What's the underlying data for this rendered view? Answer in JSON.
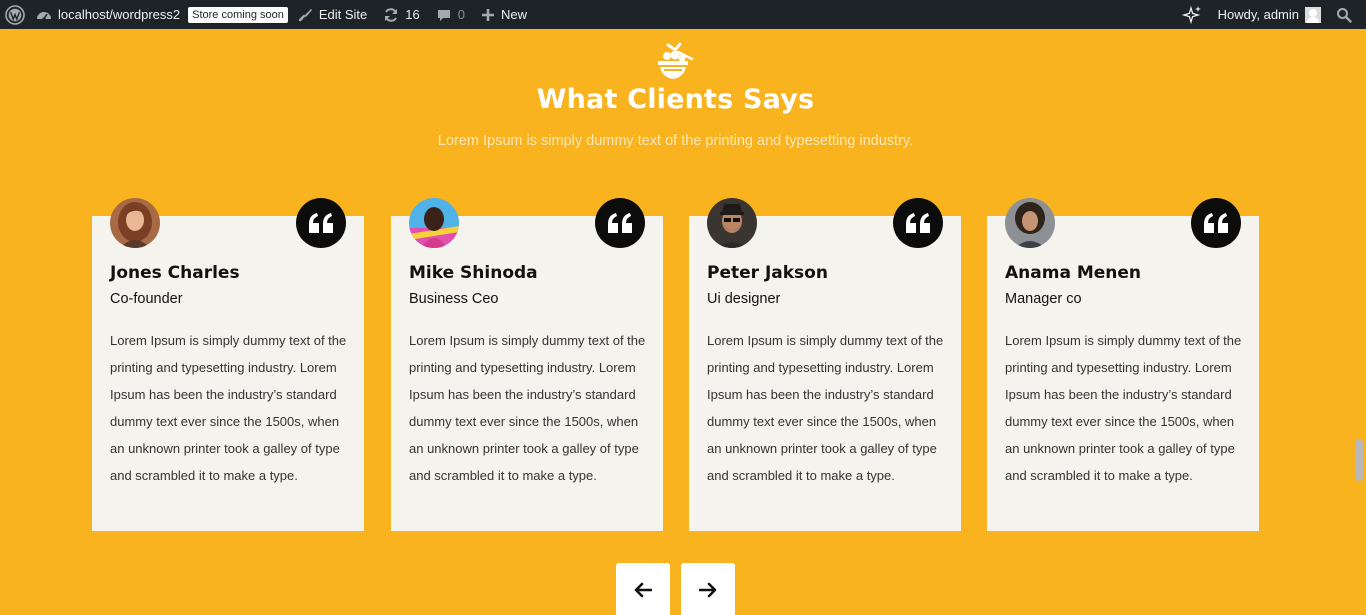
{
  "adminbar": {
    "site_url": "localhost/wordpress2",
    "store_badge": "Store coming soon",
    "edit_site": "Edit Site",
    "updates_count": "16",
    "comments_count": "0",
    "new_label": "New",
    "howdy": "Howdy, admin",
    "icons": [
      "wordpress-icon",
      "dashboard-icon",
      "brush-icon",
      "updates-icon",
      "comment-icon",
      "plus-icon",
      "sparkle-icon",
      "avatar-icon",
      "search-icon"
    ]
  },
  "section": {
    "icon": "food-bowl-icon",
    "title": "What Clients Says",
    "subtitle": "Lorem Ipsum is simply dummy text of the printing and typesetting industry."
  },
  "testimonials": [
    {
      "name": "Jones Charles",
      "role": "Co-founder",
      "text": "Lorem Ipsum is simply dummy text of the printing and typesetting industry. Lorem Ipsum has been the industry’s standard dummy text ever since the 1500s, when an unknown printer took a galley of type and scrambled it to make a type."
    },
    {
      "name": "Mike Shinoda",
      "role": "Business Ceo",
      "text": "Lorem Ipsum is simply dummy text of the printing and typesetting industry. Lorem Ipsum has been the industry’s standard dummy text ever since the 1500s, when an unknown printer took a galley of type and scrambled it to make a type."
    },
    {
      "name": "Peter Jakson",
      "role": "Ui designer",
      "text": "Lorem Ipsum is simply dummy text of the printing and typesetting industry. Lorem Ipsum has been the industry’s standard dummy text ever since the 1500s, when an unknown printer took a galley of type and scrambled it to make a type."
    },
    {
      "name": "Anama Menen",
      "role": "Manager co",
      "text": "Lorem Ipsum is simply dummy text of the printing and typesetting industry. Lorem Ipsum has been the industry’s standard dummy text ever since the 1500s, when an unknown printer took a galley of type and scrambled it to make a type."
    }
  ],
  "colors": {
    "background": "#f8b31f",
    "card": "#f5f3ee",
    "adminbar": "#1d2327",
    "quote_badge": "#0c0c0c"
  },
  "nav": {
    "prev_icon": "arrow-left-icon",
    "next_icon": "arrow-right-icon"
  }
}
